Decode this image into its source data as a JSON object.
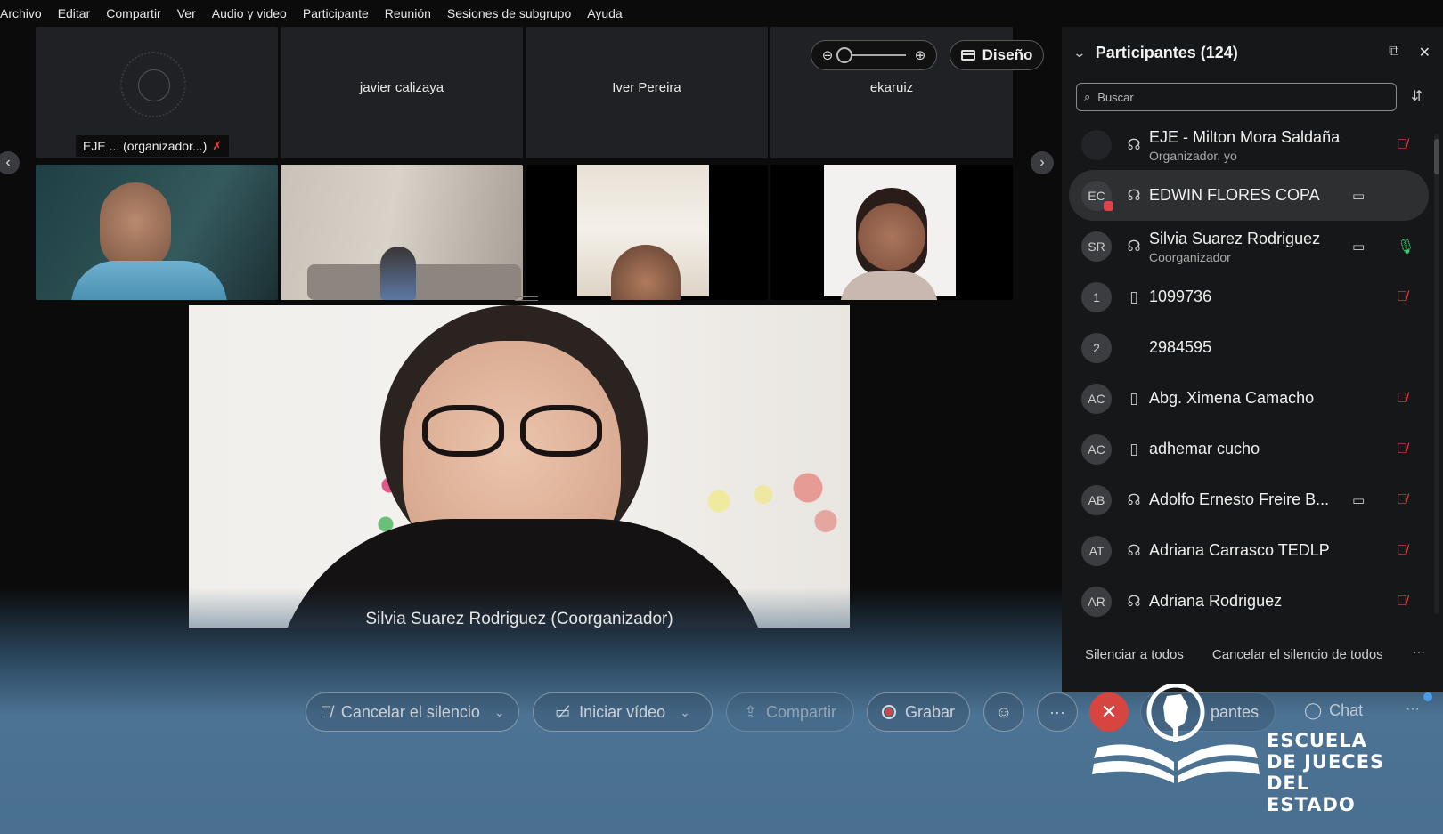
{
  "menu": [
    "Archivo",
    "Editar",
    "Compartir",
    "Ver",
    "Audio y video",
    "Participante",
    "Reunión",
    "Sesiones de subgrupo",
    "Ayuda"
  ],
  "zoom": {
    "out_icon": "zoom-out-icon",
    "in_icon": "zoom-in-icon",
    "level": 0.05
  },
  "layout_button": {
    "label": "Diseño"
  },
  "tiles": {
    "t1_label": "EJE ... (organizador...)",
    "t2_name": "javier calizaya",
    "t3_name": "Iver Pereira",
    "t4_name": "ekaruiz"
  },
  "main_video": {
    "caption": "Silvia Suarez Rodriguez (Coorganizador)"
  },
  "participants": {
    "title": "Participantes (124)",
    "search_placeholder": "Buscar",
    "list": [
      {
        "initials": "",
        "name": "EJE - Milton Mora Saldaña",
        "role": "Organizador, yo",
        "conn": "headset",
        "cam": false,
        "mic": "off"
      },
      {
        "initials": "EC",
        "name": "EDWIN FLORES COPA",
        "role": "",
        "conn": "headset",
        "cam": true,
        "mic": "none"
      },
      {
        "initials": "SR",
        "name": "Silvia Suarez Rodriguez",
        "role": "Coorganizador",
        "conn": "headset",
        "cam": true,
        "mic": "on"
      },
      {
        "initials": "1",
        "name": "1099736",
        "role": "",
        "conn": "phone",
        "cam": false,
        "mic": "off"
      },
      {
        "initials": "2",
        "name": "2984595",
        "role": "",
        "conn": "none",
        "cam": false,
        "mic": "none"
      },
      {
        "initials": "AC",
        "name": "Abg. Ximena Camacho",
        "role": "",
        "conn": "phone",
        "cam": false,
        "mic": "off"
      },
      {
        "initials": "AC",
        "name": "adhemar cucho",
        "role": "",
        "conn": "phone",
        "cam": false,
        "mic": "off"
      },
      {
        "initials": "AB",
        "name": "Adolfo Ernesto Freire B...",
        "role": "",
        "conn": "headset",
        "cam": true,
        "mic": "off"
      },
      {
        "initials": "AT",
        "name": "Adriana Carrasco TEDLP",
        "role": "",
        "conn": "headset",
        "cam": false,
        "mic": "off"
      },
      {
        "initials": "AR",
        "name": "Adriana Rodriguez",
        "role": "",
        "conn": "headset",
        "cam": false,
        "mic": "off"
      }
    ],
    "mute_all": "Silenciar a todos",
    "unmute_all": "Cancelar el silencio de todos"
  },
  "controls": {
    "mute": "Cancelar el silencio",
    "video": "Iniciar vídeo",
    "share": "Compartir",
    "record": "Grabar",
    "participants_partial": "pantes",
    "chat": "Chat"
  },
  "logo": {
    "line1": "ESCUELA",
    "line2": "DE JUECES",
    "line3": "DEL ESTADO"
  },
  "colors": {
    "accent_red": "#e0424a",
    "mic_on": "#3ecf6f",
    "panel_bg": "#161718",
    "bottom_blue": "#4a6f90"
  }
}
